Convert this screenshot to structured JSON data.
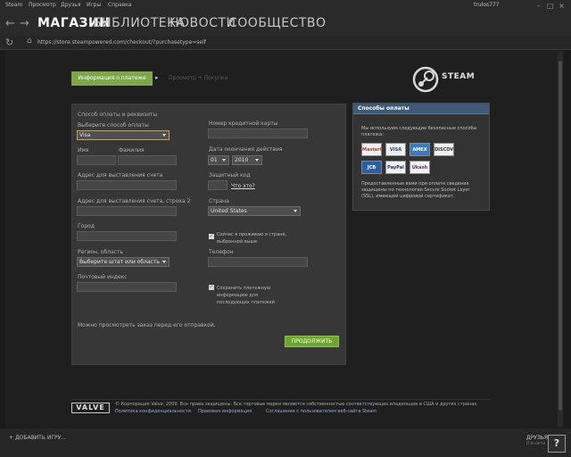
{
  "menubar": {
    "items": [
      "Steam",
      "Просмотр",
      "Друзья",
      "Игры",
      "Справка"
    ],
    "username": "trulos777"
  },
  "nav": {
    "tabs": [
      "МАГАЗИН",
      "БИБЛИОТЕКА",
      "НОВОСТИ",
      "СООБЩЕСТВО"
    ],
    "active_tab": "МАГАЗИН"
  },
  "address": {
    "url": "https://store.steampowered.com/checkout/?purchasetype=self"
  },
  "steps": {
    "step1": "Информация о платеже",
    "step2": "Просмотр + Покупка"
  },
  "logo": {
    "text": "STEAM"
  },
  "form": {
    "section_title": "Способ оплаты и реквизиты",
    "payment_method_label": "Выберите способ оплаты",
    "payment_method_value": "Visa",
    "first_name_label": "Имя",
    "last_name_label": "Фамилия",
    "billing_address_label": "Адрес для выставления счета",
    "billing_address2_label": "Адрес для выставления счета, строка 2",
    "city_label": "Город",
    "region_label": "Регион, область",
    "region_value": "Выберите штат или область",
    "zip_label": "Почтовый индекс",
    "card_number_label": "Номер кредитной карты",
    "expiration_label": "Дата окончания действия",
    "exp_month": "01",
    "exp_year": "2010",
    "security_code_label": "Защитный код",
    "security_help": "Что это?",
    "country_label": "Страна",
    "country_value": "United States",
    "reside_checkbox_label": "Сейчас я проживаю в стране, выбранной выше",
    "phone_label": "Телефон",
    "save_checkbox_label": "Сохранить платежную информацию для последующих платежей",
    "review_note": "Можно просмотреть заказ перед его отправкой.",
    "submit_label": "ПРОДОЛЖИТЬ"
  },
  "payment_panel": {
    "title": "Способы оплаты",
    "intro": "Мы используем следующие безопасные способы платежа:",
    "cards": [
      {
        "name": "MasterCard",
        "icon": "mastercard-icon",
        "bg": "#f2f2f2",
        "color": "#c0392b"
      },
      {
        "name": "VISA",
        "icon": "visa-icon",
        "bg": "#f2f2f2",
        "color": "#1a3d8f"
      },
      {
        "name": "AMEX",
        "icon": "amex-icon",
        "bg": "#3b7bbf",
        "color": "#ffffff"
      },
      {
        "name": "DISCOVER",
        "icon": "discover-icon",
        "bg": "#f2f2f2",
        "color": "#333333"
      },
      {
        "name": "JCB",
        "icon": "jcb-icon",
        "bg": "#2a5fa8",
        "color": "#ffffff"
      },
      {
        "name": "PayPal",
        "icon": "paypal-icon",
        "bg": "#f2f2f2",
        "color": "#17306e"
      },
      {
        "name": "Ukash",
        "icon": "ukash-icon",
        "bg": "#f2f2f2",
        "color": "#5a2a72"
      }
    ],
    "ssl_note": "Предоставленные вами при оплате сведения защищены по технологии Secure Socket Layer (SSL), имеющей цифровой сертификат."
  },
  "footer": {
    "valve_logo": "VALVE",
    "copyright": "© Корпорация Valve, 2009. Все права защищены. Все торговые марки являются собственностью соответствующих владельцев в США и других странах.",
    "links": [
      "Политика конфиденциальности",
      "Правовая информация",
      "Соглашение с пользователем веб-сайта Steam"
    ]
  },
  "bottom": {
    "add_game": "ДОБАВИТЬ ИГРУ...",
    "friends": "ДРУЗЬЯ",
    "online": "0 в сети",
    "help": "?"
  },
  "colors": {
    "accent_green": "#7ea64b",
    "panel_blue": "#3f5a77"
  }
}
